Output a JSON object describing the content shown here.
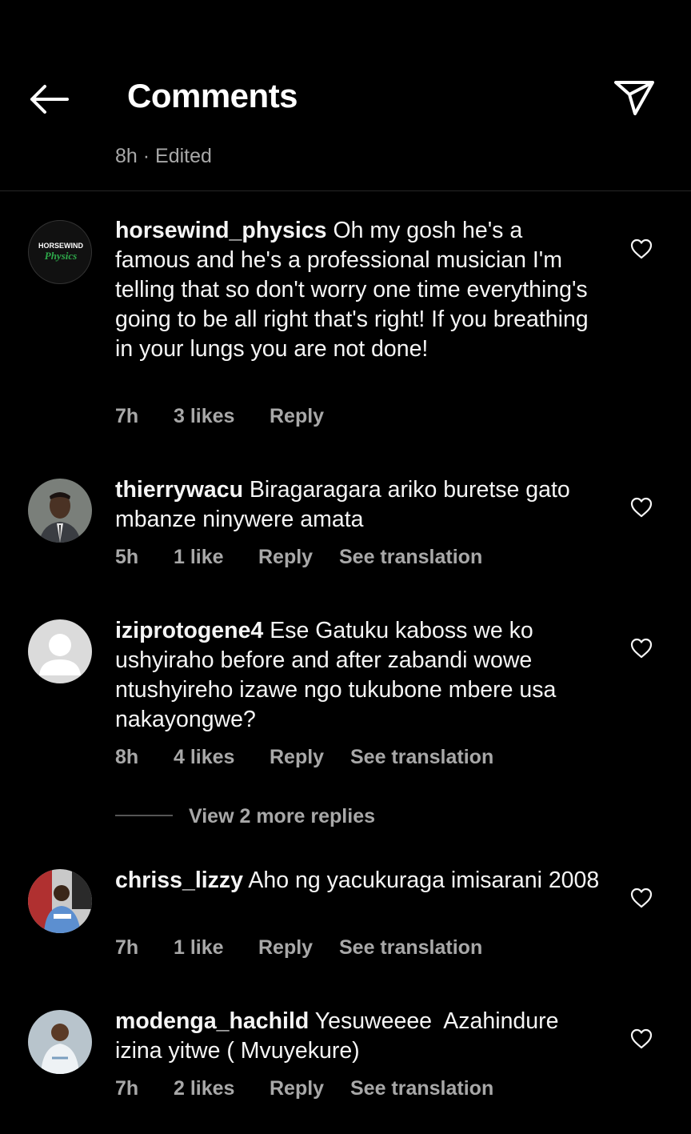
{
  "header": {
    "title": "Comments",
    "post_meta": "8h · Edited"
  },
  "comments": [
    {
      "username": "horsewind_physics",
      "text": "Oh my gosh he's a famous and he's a professional musician I'm telling that so don't worry one time everything's going to be all right that's right! If you breathing in your lungs you are not done!",
      "time": "7h",
      "likes": "3 likes",
      "reply": "Reply",
      "avatar_text_1": "HORSEWIND",
      "avatar_text_2": "Physics"
    },
    {
      "username": "thierrywacu",
      "text": "Biragaragara ariko buretse gato mbanze ninywere amata",
      "time": "5h",
      "likes": "1 like",
      "reply": "Reply",
      "translation": "See translation"
    },
    {
      "username": "iziprotogene4",
      "text": "Ese Gatuku kaboss we ko ushyiraho before and after zabandi wowe ntushyireho izawe ngo tukubone mbere usa nakayongwe?",
      "time": "8h",
      "likes": "4 likes",
      "reply": "Reply",
      "translation": "See translation",
      "more_replies": "View 2 more replies"
    },
    {
      "username": "chriss_lizzy",
      "text": "Aho ng yacukuraga imisarani 2008",
      "time": "7h",
      "likes": "1 like",
      "reply": "Reply",
      "translation": "See translation"
    },
    {
      "username": "modenga_hachild",
      "text": "Yesuweeee  Azahindure izina yitwe ( Mvuyekure)",
      "time": "7h",
      "likes": "2 likes",
      "reply": "Reply",
      "translation": "See translation"
    }
  ],
  "colors": {
    "background": "#000000",
    "text": "#f5f5f5",
    "muted": "#a8a8a8",
    "divider": "#262626"
  },
  "icons": [
    "back-arrow-icon",
    "share-icon",
    "heart-icon"
  ]
}
